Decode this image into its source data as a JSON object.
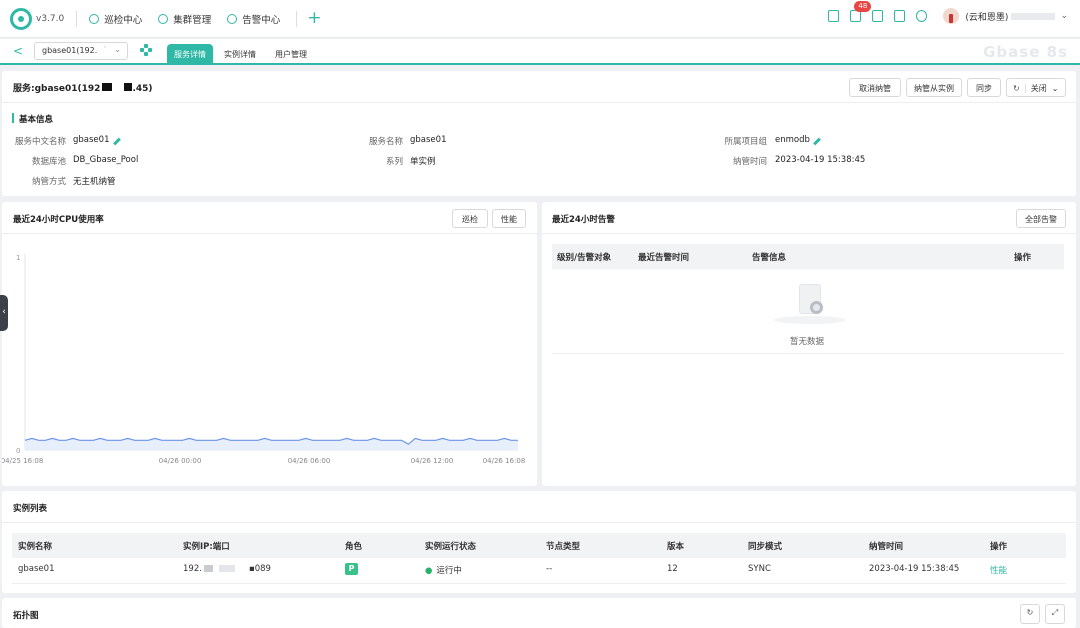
{
  "app": {
    "version": "v3.7.0",
    "product": "Gbase 8s"
  },
  "nav": {
    "items": [
      {
        "label": "巡检中心"
      },
      {
        "label": "集群管理"
      },
      {
        "label": "告警中心"
      }
    ],
    "plus": "+",
    "badge": "48",
    "user": "(云和恩墨)"
  },
  "subbar": {
    "service_select": "gbase01(192.",
    "tabs": [
      {
        "label": "服务详情"
      },
      {
        "label": "实例详情"
      },
      {
        "label": "用户管理"
      }
    ]
  },
  "service": {
    "title": "服务:gbase01(192",
    "title_suffix": ".45)",
    "buttons": {
      "cancel": "取消纳管",
      "manage_from_instance": "纳管从实例",
      "sync": "同步",
      "close": "关闭"
    }
  },
  "basic": {
    "title": "基本信息",
    "fields": {
      "cn_name_label": "服务中文名称",
      "cn_name": "gbase01",
      "name_label": "服务名称",
      "name": "gbase01",
      "group_label": "所属项目组",
      "group": "enmodb",
      "pool_label": "数据库池",
      "pool": "DB_Gbase_Pool",
      "series_label": "系列",
      "series": "单实例",
      "managed_time_label": "纳管时间",
      "managed_time": "2023-04-19 15:38:45",
      "manage_mode_label": "纳管方式",
      "manage_mode": "无主机纳管"
    }
  },
  "cpu": {
    "title": "最近24小时CPU使用率",
    "btn_inspect": "巡检",
    "btn_perf": "性能"
  },
  "chart_data": {
    "type": "line",
    "series": [
      {
        "values": [
          0.05,
          0.06,
          0.05,
          0.05,
          0.06,
          0.05,
          0.05,
          0.06,
          0.05,
          0.05,
          0.05,
          0.06,
          0.05,
          0.05,
          0.05,
          0.06,
          0.05,
          0.05,
          0.05,
          0.06,
          0.05,
          0.05,
          0.05,
          0.05,
          0.06,
          0.05,
          0.05,
          0.05,
          0.05,
          0.06,
          0.05,
          0.05,
          0.05,
          0.05,
          0.05,
          0.06,
          0.05,
          0.05,
          0.05,
          0.05,
          0.05,
          0.06,
          0.05,
          0.05,
          0.05,
          0.05,
          0.05,
          0.06,
          0.05,
          0.05,
          0.05,
          0.06,
          0.05,
          0.05,
          0.05,
          0.05,
          0.03,
          0.06,
          0.05,
          0.05,
          0.05,
          0.06,
          0.05,
          0.05,
          0.05,
          0.06,
          0.05,
          0.05,
          0.05,
          0.05,
          0.06,
          0.05,
          0.05
        ]
      }
    ],
    "x_ticks": [
      "04/25 16:08",
      "04/26 00:00",
      "04/26 06:00",
      "04/26 12:00",
      "04/26 16:08"
    ],
    "ylim": [
      0,
      1
    ],
    "y_ticks": [
      "0",
      "1"
    ],
    "color": "#6d95e8",
    "grid": false
  },
  "alarm": {
    "title": "最近24小时告警",
    "btn_all": "全部告警",
    "columns": [
      "级别/告警对象",
      "最近告警时间",
      "告警信息",
      "操作"
    ],
    "empty": "暂无数据"
  },
  "instances": {
    "title": "实例列表",
    "columns": [
      "实例名称",
      "实例IP:端口",
      "角色",
      "实例运行状态",
      "节点类型",
      "版本",
      "同步模式",
      "纳管时间",
      "操作"
    ],
    "rows": [
      {
        "name": "gbase01",
        "ip_prefix": "192.",
        "ip_suffix": "089",
        "role": "P",
        "status": "运行中",
        "node_type": "--",
        "version": "12",
        "sync": "SYNC",
        "managed_time": "2023-04-19 15:38:45",
        "op": "性能"
      }
    ]
  },
  "topology": {
    "title": "拓扑图"
  },
  "colors": {
    "accent": "#2fb8a6",
    "status_ok": "#27b36b",
    "badge": "#e84545",
    "line": "#6d95e8"
  }
}
